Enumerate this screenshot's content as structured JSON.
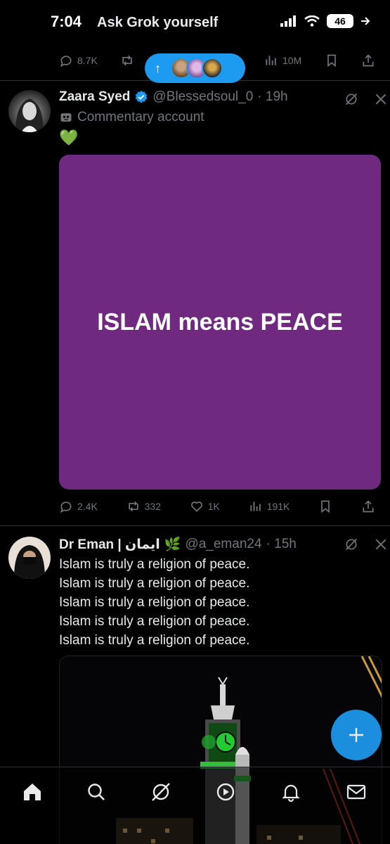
{
  "status_bar": {
    "time": "7:04",
    "title": "Ask Grok yourself",
    "battery": "46"
  },
  "top_actions": {
    "replies": "8.7K",
    "views": "10M"
  },
  "tweet1": {
    "name": "Zaara Syed",
    "handle": "@Blessedsoul_0",
    "time": "· 19h",
    "label": "Commentary account",
    "emoji": "💚",
    "card_text": "ISLAM means PEACE",
    "replies": "2.4K",
    "reposts": "332",
    "likes": "1K",
    "views": "191K"
  },
  "tweet2": {
    "name": "Dr Eman | ايمان",
    "name_emoji": "🌿",
    "handle": "@a_eman24",
    "time": "· 15h",
    "lines": [
      "Islam is truly a religion of peace.",
      "Islam is truly a religion of peace.",
      "Islam is truly a religion of peace.",
      "Islam is truly a religion of peace.",
      "Islam is truly a religion of peace."
    ]
  },
  "fab": {
    "label": "+"
  },
  "colors": {
    "accent": "#1d9bf0",
    "card": "#6f2a80",
    "muted": "#71767b"
  }
}
